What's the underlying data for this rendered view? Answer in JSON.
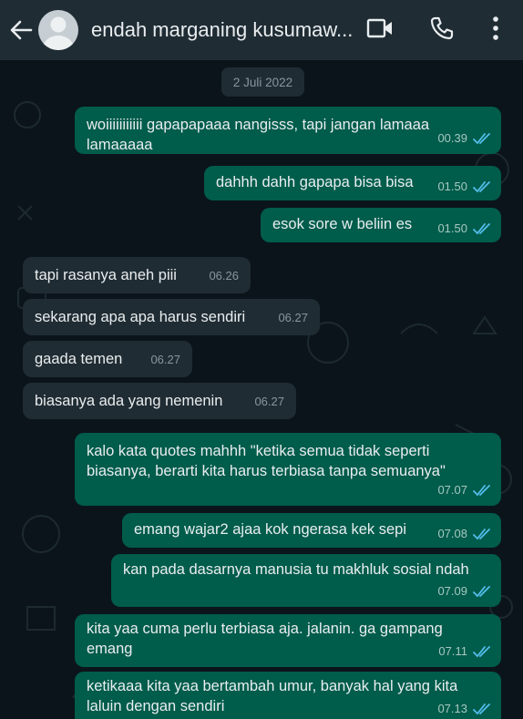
{
  "header": {
    "back_icon": "arrow-left-icon",
    "contact_name": "endah marganing kusumaw...",
    "video_icon": "video-camera-icon",
    "call_icon": "phone-icon",
    "menu_icon": "more-vertical-icon"
  },
  "chat": {
    "date": "2 Juli 2022",
    "messages": [
      {
        "dir": "out",
        "text": "woiiiiiiiiiii gapapapaaa nangisss, tapi jangan lamaaa\nlamaaaaa",
        "time": "00.39"
      },
      {
        "dir": "out",
        "text": "dahhh dahh gapapa bisa bisa",
        "time": "01.50"
      },
      {
        "dir": "out",
        "text": "esok sore w beliin es",
        "time": "01.50"
      },
      {
        "dir": "in",
        "text": "tapi rasanya aneh piii",
        "time": "06.26"
      },
      {
        "dir": "in",
        "text": "sekarang apa apa harus sendiri",
        "time": "06.27"
      },
      {
        "dir": "in",
        "text": "gaada temen",
        "time": "06.27"
      },
      {
        "dir": "in",
        "text": "biasanya ada yang nemenin",
        "time": "06.27"
      },
      {
        "dir": "out",
        "text": "kalo kata quotes mahhh \"ketika semua tidak seperti\nbiasanya, berarti kita harus terbiasa tanpa semuanya\"",
        "time": "07.07"
      },
      {
        "dir": "out",
        "text": "emang wajar2 ajaa kok ngerasa kek sepi",
        "time": "07.08"
      },
      {
        "dir": "out",
        "text": "kan pada dasarnya manusia tu makhluk sosial ndah",
        "time": "07.09"
      },
      {
        "dir": "out",
        "text": "kita yaa cuma perlu terbiasa aja. jalanin. ga gampang\nemang",
        "time": "07.11"
      },
      {
        "dir": "out",
        "text": "ketikaaa kita yaa bertambah umur, banyak hal yang kita\nlaluin dengan sendiri",
        "time": "07.13"
      }
    ]
  },
  "colors": {
    "header_bg": "#1f2c34",
    "chat_bg": "#0b141a",
    "outgoing_bubble": "#005c4b",
    "incoming_bubble": "#202c33",
    "read_ticks": "#53bdeb"
  }
}
